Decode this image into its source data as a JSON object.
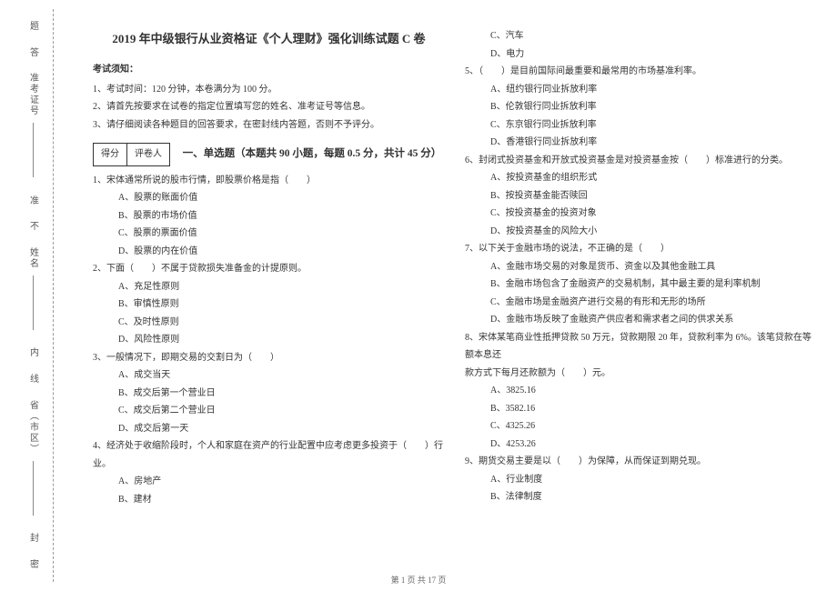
{
  "binding": {
    "seal_char1": "题",
    "answer_char": "答",
    "cert_label": "准考证号",
    "zhun_char": "准",
    "no_char": "不",
    "name_label": "姓名",
    "inside_char": "内",
    "line_char": "线",
    "region_label": "省（市区）",
    "feng_char": "封",
    "mi_char": "密"
  },
  "header": {
    "title": "2019 年中级银行从业资格证《个人理财》强化训练试题 C 卷",
    "notice_head": "考试须知：",
    "notice1": "1、考试时间：120 分钟，本卷满分为 100 分。",
    "notice2": "2、请首先按要求在试卷的指定位置填写您的姓名、准考证号等信息。",
    "notice3": "3、请仔细阅读各种题目的回答要求，在密封线内答题，否则不予评分。",
    "score_left": "得分",
    "score_right": "评卷人",
    "section1": "一、单选题（本题共 90 小题，每题 0.5 分，共计 45 分）"
  },
  "col1": {
    "q1": "1、宋体通常所说的股市行情，即股票价格是指（　　）",
    "q1a": "A、股票的账面价值",
    "q1b": "B、股票的市场价值",
    "q1c": "C、股票的票面价值",
    "q1d": "D、股票的内在价值",
    "q2": "2、下面（　　）不属于贷款损失准备金的计提原则。",
    "q2a": "A、充足性原则",
    "q2b": "B、审慎性原则",
    "q2c": "C、及时性原则",
    "q2d": "D、风险性原则",
    "q3": "3、一般情况下，即期交易的交割日为（　　）",
    "q3a": "A、成交当天",
    "q3b": "B、成交后第一个营业日",
    "q3c": "C、成交后第二个营业日",
    "q3d": "D、成交后第一天",
    "q4": "4、经济处于收缩阶段时，个人和家庭在资产的行业配置中应考虑更多投资于（　　）行业。",
    "q4a": "A、房地产",
    "q4b": "B、建材"
  },
  "col2": {
    "q4c": "C、汽车",
    "q4d": "D、电力",
    "q5": "5、（　　）是目前国际间最重要和最常用的市场基准利率。",
    "q5a": "A、纽约银行同业拆放利率",
    "q5b": "B、伦敦银行同业拆放利率",
    "q5c": "C、东京银行同业拆放利率",
    "q5d": "D、香港银行同业拆放利率",
    "q6": "6、封闭式投资基金和开放式投资基金是对投资基金按（　　）标准进行的分类。",
    "q6a": "A、按投资基金的组织形式",
    "q6b": "B、按投资基金能否赎回",
    "q6c": "C、按投资基金的投资对象",
    "q6d": "D、按投资基金的风险大小",
    "q7": "7、以下关于金融市场的说法，不正确的是（　　）",
    "q7a": "A、金融市场交易的对象是货币、资金以及其他金融工具",
    "q7b": "B、金融市场包含了金融资产的交易机制，其中最主要的是利率机制",
    "q7c": "C、金融市场是金融资产进行交易的有形和无形的场所",
    "q7d": "D、金融市场反映了金融资产供应者和需求者之间的供求关系",
    "q8a_line1": "8、宋体某笔商业性抵押贷款 50 万元，贷款期限 20 年，贷款利率为 6%。该笔贷款在等额本息还",
    "q8a_line2": "款方式下每月还款额为（　　）元。",
    "q8a": "A、3825.16",
    "q8b": "B、3582.16",
    "q8c": "C、4325.26",
    "q8d": "D、4253.26",
    "q9": "9、期货交易主要是以（　　）为保障，从而保证到期兑现。",
    "q9a": "A、行业制度",
    "q9b": "B、法律制度"
  },
  "footer": "第 1 页 共 17 页"
}
